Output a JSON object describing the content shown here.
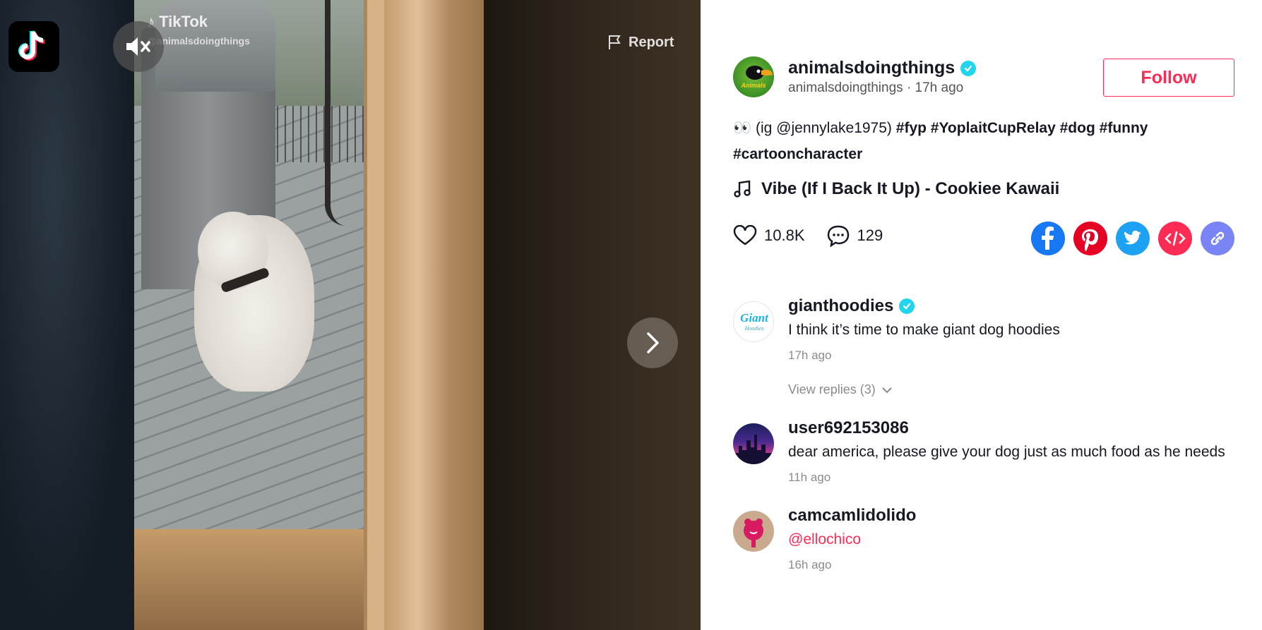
{
  "video": {
    "watermark_brand": "TikTok",
    "watermark_user": "@animalsdoingthings",
    "report_label": "Report"
  },
  "author": {
    "username": "animalsdoingthings",
    "meta": "animalsdoingthings · 17h ago",
    "follow_label": "Follow",
    "verified": true
  },
  "caption": {
    "prefix": "👀 (ig @jennylake1975)",
    "tags": [
      "#fyp",
      "#YoplaitCupRelay",
      "#dog",
      "#funny",
      "#cartooncharacter"
    ]
  },
  "music": {
    "title": "Vibe (If I Back It Up) - Cookiee Kawaii",
    "icon": "music-note-icon"
  },
  "stats": {
    "likes": "10.8K",
    "comments": "129"
  },
  "share": {
    "icons": [
      "facebook-icon",
      "pinterest-icon",
      "twitter-icon",
      "embed-icon",
      "link-icon"
    ],
    "colors": {
      "facebook": "#1877f2",
      "pinterest": "#e60023",
      "twitter": "#1da1f2",
      "embed": "#fe2c55",
      "link": "#7a84f5"
    }
  },
  "comments": [
    {
      "user": "gianthoodies",
      "verified": true,
      "text": "I think it’s time to make giant dog hoodies",
      "time": "17h ago",
      "replies": "View replies (3)"
    },
    {
      "user": "user692153086",
      "verified": false,
      "text": "dear america, please give your dog just as much food as he needs",
      "time": "11h ago"
    },
    {
      "user": "camcamlidolido",
      "verified": false,
      "text": "@ellochico",
      "time": "16h ago"
    }
  ],
  "colors": {
    "accent": "#fe2c55",
    "verified": "#20d5ec",
    "text": "#161823",
    "muted": "#8a8b91"
  }
}
